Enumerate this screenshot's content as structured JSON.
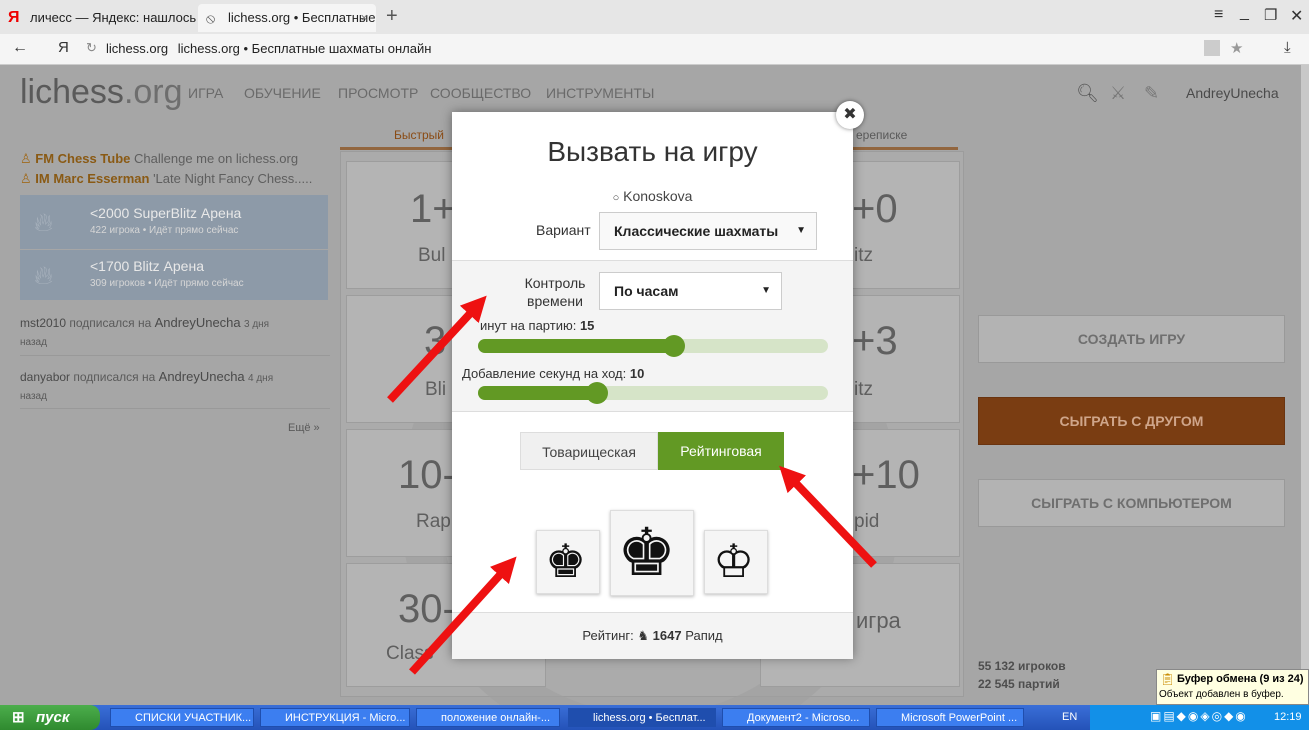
{
  "browser": {
    "tabs": [
      {
        "label": "личесс — Яндекс: нашлось"
      },
      {
        "label": "lichess.org • Бесплатные"
      }
    ],
    "close_tab": "×",
    "new_tab": "+",
    "address_host": "lichess.org",
    "address_title": "lichess.org • Бесплатные шахматы онлайн"
  },
  "site": {
    "logo": "lichess",
    "logo_suffix": ".org",
    "nav": [
      "ИГРА",
      "ОБУЧЕНИЕ",
      "ПРОСМОТР",
      "СООБЩЕСТВО",
      "ИНСТРУМЕНТЫ"
    ],
    "username": "AndreyUnecha",
    "lobby_tabs": [
      "Быстрый",
      "ереписке"
    ]
  },
  "sidebar": {
    "streams": [
      {
        "title": "FM Chess Tube",
        "text": "Challenge me on lichess.org"
      },
      {
        "title": "IM Marc Esserman",
        "text": "'Late Night Fancy Chess....."
      }
    ],
    "tournaments": [
      {
        "name": "<2000 SuperBlitz Арена",
        "info": "422 игрока • Идёт прямо сейчас"
      },
      {
        "name": "<1700 Blitz Арена",
        "info": "309 игроков • Идёт прямо сейчас"
      }
    ],
    "timeline": [
      {
        "user": "mst2010",
        "text": "подписался на",
        "target": "AndreyUnecha",
        "when": "3 дня",
        "when2": "назад"
      },
      {
        "user": "danyabor",
        "text": "подписался на",
        "target": "AndreyUnecha",
        "when": "4 дня",
        "when2": "назад"
      }
    ],
    "more": "Ещё »"
  },
  "pools": {
    "left": [
      {
        "time": "1+",
        "name": "Bul"
      },
      {
        "time": "3",
        "name": "Bli"
      },
      {
        "time": "10-",
        "name": "Rap"
      },
      {
        "time": "30-",
        "name": "Class"
      }
    ],
    "right": [
      {
        "time": "+0",
        "name": "itz"
      },
      {
        "time": "+3",
        "name": "itz"
      },
      {
        "time": "+10",
        "name": "pid"
      },
      {
        "time": "",
        "name": "игра"
      }
    ]
  },
  "right_buttons": {
    "create": "СОЗДАТЬ ИГРУ",
    "friend": "СЫГРАТЬ С ДРУГОМ",
    "computer": "СЫГРАТЬ С КОМПЬЮТЕРОМ"
  },
  "stats": {
    "players": "55 132 игроков",
    "games": "22 545 партий"
  },
  "modal": {
    "close": "✖",
    "title": "Вызвать на игру",
    "opponent": "Konoskova",
    "variant_label": "Вариант",
    "variant_value": "Классические шахматы",
    "time_control_label_1": "Контроль",
    "time_control_label_2": "времени",
    "time_control_value": "По часам",
    "minutes_label": "инут на партию:",
    "minutes_value": "15",
    "minutes_fraction": 0.56,
    "increment_label": "Добавление секунд на ход:",
    "increment_value": "10",
    "increment_fraction": 0.34,
    "casual": "Товарищеская",
    "rated": "Рейтинговая",
    "rating_label": "Рейтинг:",
    "rating_value": "1647",
    "rating_perf": "Рапид"
  },
  "taskbar": {
    "start": "пуск",
    "tasks": [
      "СПИСКИ УЧАСТНИК...",
      "ИНСТРУКЦИЯ - Micro...",
      "положение онлайн-...",
      "lichess.org • Бесплат...",
      "Документ2 - Microso...",
      "Microsoft PowerPoint ..."
    ],
    "lang": "EN",
    "clock": "12:19"
  },
  "tray_popup": {
    "title": "Буфер обмена (9 из 24)",
    "text": "Объект добавлен в буфер."
  },
  "colors": {
    "green": "#629924",
    "orange": "#b85b1a",
    "arrow": "#ee1111"
  }
}
